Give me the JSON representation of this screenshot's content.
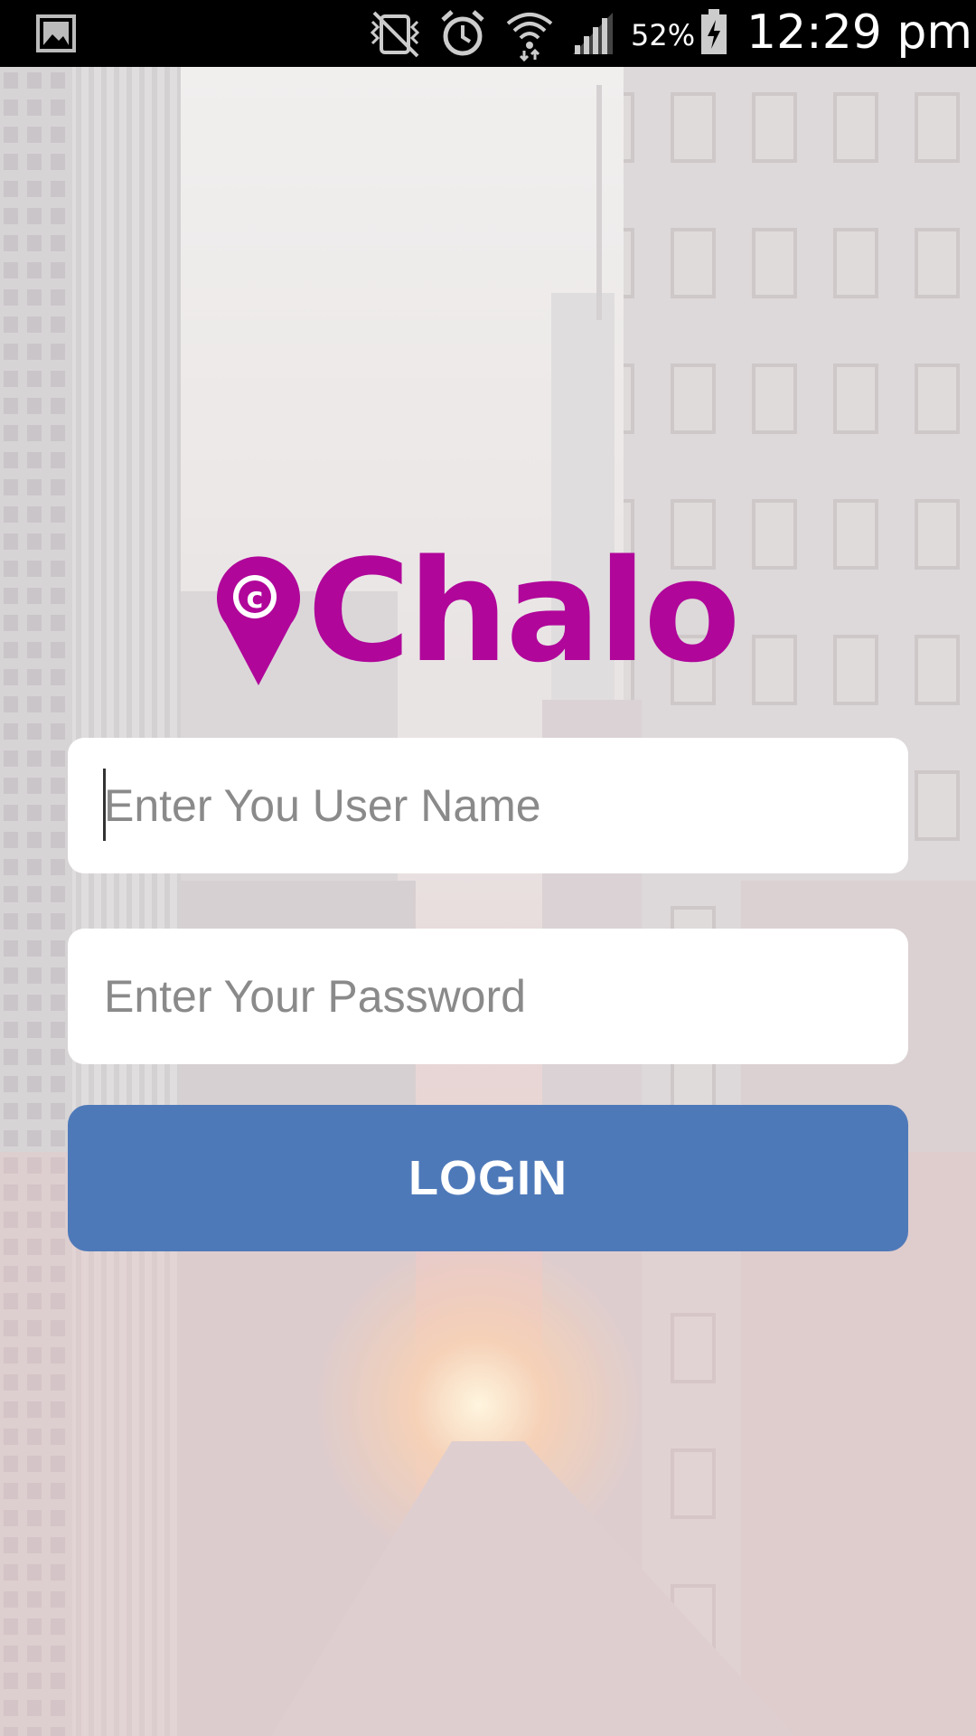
{
  "status_bar": {
    "battery": "52%",
    "time": "12:29 pm",
    "icons": [
      "gallery-icon",
      "vibrate-mute-icon",
      "alarm-icon",
      "wifi-icon",
      "signal-icon",
      "battery-icon"
    ]
  },
  "logo": {
    "text": "Chalo",
    "color": "#b0069a"
  },
  "form": {
    "username_placeholder": "Enter You User Name",
    "username_value": "",
    "password_placeholder": "Enter Your Password",
    "password_value": "",
    "login_label": "LOGIN",
    "login_color": "#4e79b9"
  }
}
